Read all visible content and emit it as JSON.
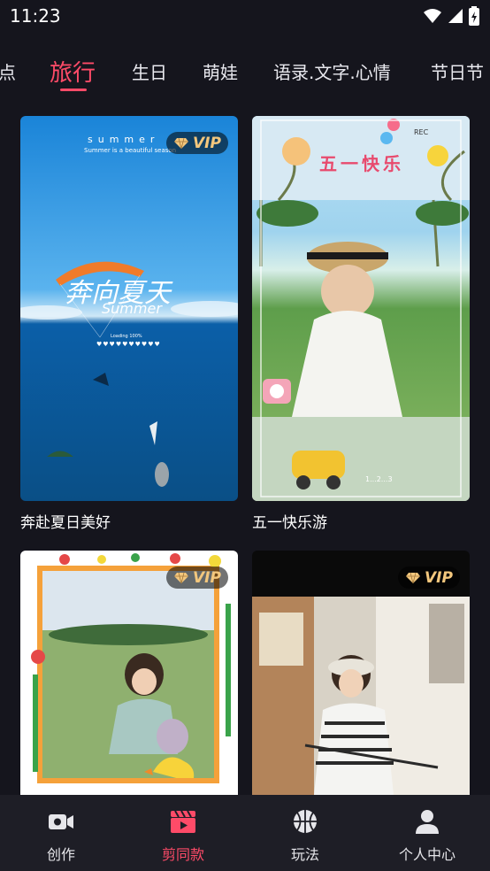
{
  "status_bar": {
    "time": "11:23"
  },
  "tabs": [
    "点",
    "旅行",
    "生日",
    "萌娃",
    "语录.文字.心情",
    "节日节"
  ],
  "active_tab": "旅行",
  "cards": [
    {
      "title": "奔赴夏日美好",
      "vip": "VIP",
      "overlay_text": "summer",
      "overlay_subtext": "Summer is a beautiful season",
      "art_text": "奔向夏天",
      "art_script": "Summer",
      "loading_text": "Loading",
      "loading_pct": "100%"
    },
    {
      "title": "五一快乐游",
      "badge_text": "五一快乐",
      "rec_text": "REC",
      "counter_text": "1...2...3"
    },
    {
      "title": "",
      "vip": "VIP"
    },
    {
      "title": "",
      "vip": "VIP"
    }
  ],
  "bottom_nav": [
    {
      "label": "创作",
      "icon": "video-camera-icon"
    },
    {
      "label": "剪同款",
      "icon": "clapperboard-icon",
      "active": true
    },
    {
      "label": "玩法",
      "icon": "basketball-icon"
    },
    {
      "label": "个人中心",
      "icon": "person-icon"
    }
  ],
  "colors": {
    "accent": "#ff4b68",
    "background": "#15151d",
    "nav_bg": "#1e1e26",
    "vip_gold": "#f3c77d"
  }
}
